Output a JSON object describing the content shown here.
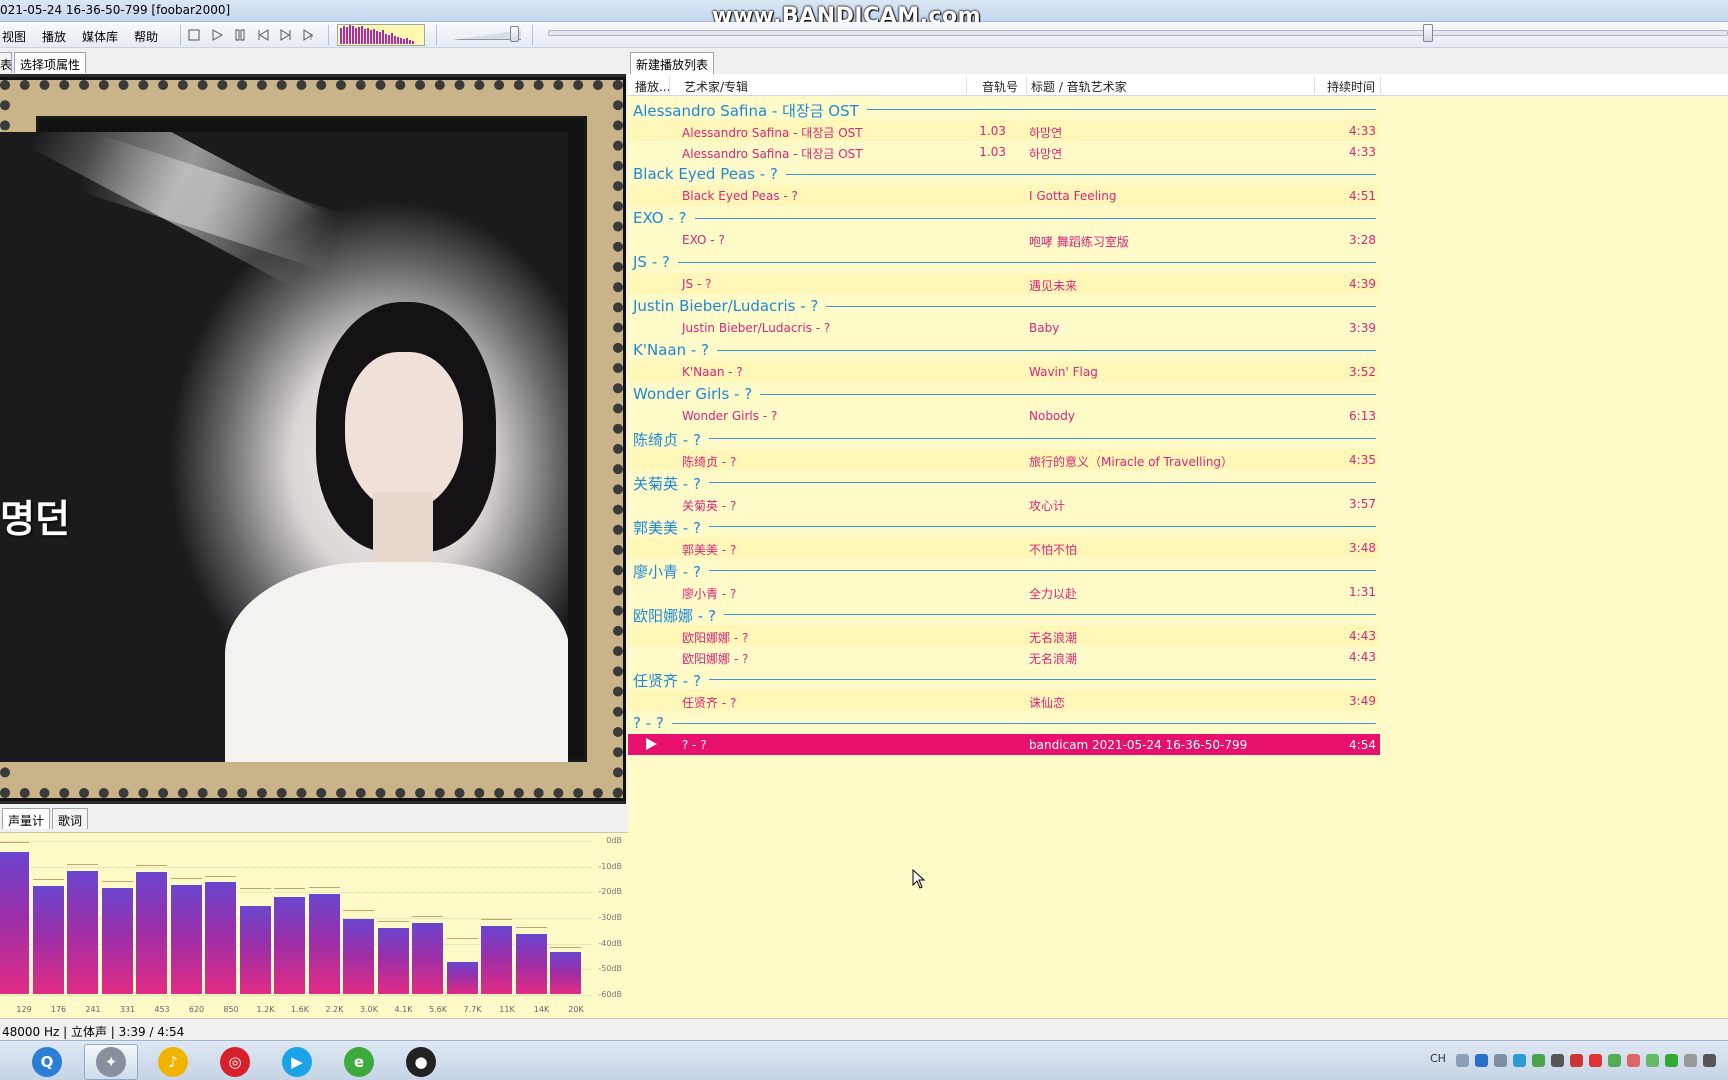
{
  "window": {
    "title": "021-05-24 16-36-50-799  [foobar2000]",
    "watermark": "www.BANDICAM.com"
  },
  "menu": {
    "items": [
      "视图",
      "播放",
      "媒体库",
      "帮助"
    ]
  },
  "toolbar": {
    "buttons": [
      "stop-icon",
      "play-icon",
      "pause-icon",
      "previous-icon",
      "next-icon",
      "random-icon"
    ],
    "volume_level": 1.0,
    "seek_position": 0.745
  },
  "left_panel": {
    "tabs": [
      "表",
      "选择项属性"
    ],
    "bottom_tabs": [
      "声量计",
      "歌词"
    ],
    "album_art_text": "명던"
  },
  "spectrum": {
    "db_labels": [
      "0dB",
      "-10dB",
      "-20dB",
      "-30dB",
      "-40dB",
      "-50dB",
      "-60dB"
    ],
    "freq_labels": [
      "129",
      "176",
      "241",
      "331",
      "453",
      "620",
      "850",
      "1.2K",
      "1.6K",
      "2.2K",
      "3.0K",
      "4.1K",
      "5.6K",
      "7.7K",
      "11K",
      "14K",
      "20K"
    ],
    "bar_levels": [
      0.92,
      0.7,
      0.8,
      0.69,
      0.79,
      0.71,
      0.73,
      0.57,
      0.63,
      0.65,
      0.49,
      0.43,
      0.46,
      0.21,
      0.44,
      0.39,
      0.27
    ],
    "peak_levels": [
      0.98,
      0.74,
      0.84,
      0.73,
      0.83,
      0.75,
      0.76,
      0.68,
      0.68,
      0.69,
      0.54,
      0.47,
      0.5,
      0.36,
      0.48,
      0.43,
      0.3
    ]
  },
  "status_bar": {
    "text": " 48000 Hz | 立体声 | 3:39 / 4:54"
  },
  "playlist": {
    "tab": "新建播放列表",
    "columns": [
      "播放...",
      "艺术家/专辑",
      "音轨号",
      "标题 / 音轨艺术家",
      "持续时间"
    ],
    "groups": [
      {
        "header": "Alessandro Safina - 대장금 OST",
        "tracks": [
          {
            "artist": "Alessandro Safina - 대장금 OST",
            "num": "1.03",
            "title": "하망연",
            "dur": "4:33"
          },
          {
            "artist": "Alessandro Safina - 대장금 OST",
            "num": "1.03",
            "title": "하망연",
            "dur": "4:33"
          }
        ]
      },
      {
        "header": "Black Eyed Peas - ?",
        "tracks": [
          {
            "artist": "Black Eyed Peas - ?",
            "num": "",
            "title": "I Gotta Feeling",
            "dur": "4:51"
          }
        ]
      },
      {
        "header": "EXO - ?",
        "tracks": [
          {
            "artist": "EXO - ?",
            "num": "",
            "title": "咆哮 舞蹈练习室版",
            "dur": "3:28"
          }
        ]
      },
      {
        "header": "JS - ?",
        "tracks": [
          {
            "artist": "JS - ?",
            "num": "",
            "title": "遇见未来",
            "dur": "4:39"
          }
        ]
      },
      {
        "header": "Justin Bieber/Ludacris - ?",
        "tracks": [
          {
            "artist": "Justin Bieber/Ludacris - ?",
            "num": "",
            "title": "Baby",
            "dur": "3:39"
          }
        ]
      },
      {
        "header": "K'Naan - ?",
        "tracks": [
          {
            "artist": "K'Naan - ?",
            "num": "",
            "title": "Wavin' Flag",
            "dur": "3:52"
          }
        ]
      },
      {
        "header": "Wonder Girls - ?",
        "tracks": [
          {
            "artist": "Wonder Girls - ?",
            "num": "",
            "title": "Nobody",
            "dur": "6:13"
          }
        ]
      },
      {
        "header": "陈绮贞 - ?",
        "tracks": [
          {
            "artist": "陈绮贞 - ?",
            "num": "",
            "title": "旅行的意义（Miracle of Travelling）",
            "dur": "4:35"
          }
        ]
      },
      {
        "header": "关菊英 - ?",
        "tracks": [
          {
            "artist": "关菊英 - ?",
            "num": "",
            "title": "攻心计",
            "dur": "3:57"
          }
        ]
      },
      {
        "header": "郭美美 - ?",
        "tracks": [
          {
            "artist": "郭美美 - ?",
            "num": "",
            "title": "不怕不怕",
            "dur": "3:48"
          }
        ]
      },
      {
        "header": "廖小青 - ?",
        "tracks": [
          {
            "artist": "廖小青 - ?",
            "num": "",
            "title": "全力以赴",
            "dur": "1:31"
          }
        ]
      },
      {
        "header": "欧阳娜娜 - ?",
        "tracks": [
          {
            "artist": "欧阳娜娜 - ?",
            "num": "",
            "title": "无名浪潮",
            "dur": "4:43"
          },
          {
            "artist": "欧阳娜娜 - ?",
            "num": "",
            "title": "无名浪潮",
            "dur": "4:43"
          }
        ]
      },
      {
        "header": "任贤齐 - ?",
        "tracks": [
          {
            "artist": "任贤齐 - ?",
            "num": "",
            "title": "诛仙恋",
            "dur": "3:49"
          }
        ]
      },
      {
        "header": "? - ?",
        "tracks": [
          {
            "artist": "? - ?",
            "num": "",
            "title": "bandicam 2021-05-24 16-36-50-799",
            "dur": "4:54",
            "playing": true
          }
        ]
      }
    ]
  },
  "taskbar": {
    "apps": [
      {
        "name": "search-app-icon",
        "color": "#2a7fd4",
        "glyph": "Q"
      },
      {
        "name": "foobar-app-icon",
        "color": "#8a8fa0",
        "glyph": "✦",
        "active": true
      },
      {
        "name": "qqmusic-app-icon",
        "color": "#f0b400",
        "glyph": "♪"
      },
      {
        "name": "netease-music-app-icon",
        "color": "#d8202a",
        "glyph": "◎"
      },
      {
        "name": "youku-app-icon",
        "color": "#1aa3e8",
        "glyph": "▶"
      },
      {
        "name": "browser-app-icon",
        "color": "#3caa3c",
        "glyph": "e"
      },
      {
        "name": "bandicam-app-icon",
        "color": "#222222",
        "glyph": "●"
      }
    ],
    "tray_text": "CH"
  },
  "colors": {
    "playlist_bg": "#fffbc8",
    "group_header": "#1e88d8",
    "track_text": "#d8277a",
    "now_playing": "#e8106d"
  }
}
